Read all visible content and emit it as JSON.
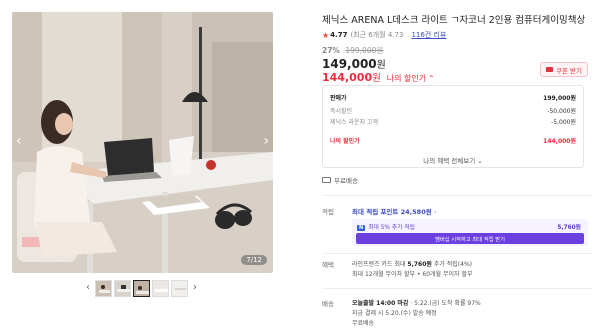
{
  "gallery": {
    "counter": "7/12",
    "prev_icon": "chevron-left-icon",
    "next_icon": "chevron-right-icon"
  },
  "product": {
    "title": "제닉스 ARENA L데스크 라이트 ㄱ자코너 2인용 컴퓨터게이밍책상",
    "rating": "4.77",
    "recent_rating": "(최근 6개월 4.73",
    "review_count": "116건 리뷰",
    "discount_pct": "27%",
    "original_price": "199,000원",
    "price": "149,000",
    "price_unit": "원",
    "my_price": "144,000",
    "my_price_unit": "원",
    "my_price_label": "나의 할인가",
    "coupon_label": "쿠폰 받기"
  },
  "breakdown": {
    "rows": [
      {
        "k": "판매가",
        "v": "199,000원"
      },
      {
        "k": "즉시할인",
        "v": "-50,000원"
      },
      {
        "k": "제닉스 라운지 고객",
        "v": "-5,000원"
      },
      {
        "k": "나의 할인가",
        "v": "144,000원"
      }
    ],
    "all_benefits": "나의 혜택 전체보기"
  },
  "shipping_free": "무료배송",
  "benefits": {
    "label": "적립",
    "points_text": "최대 적립 포인트 24,580원",
    "points_chevron": "›",
    "tag": "N",
    "extra_text": "최대 5% 추가 적립",
    "extra_amount": "5,760원",
    "button": "멤버십 시작하고 최대 적립 받기"
  },
  "payment": {
    "label": "혜택",
    "line1_pre": "라인프렌즈 카드 최대 ",
    "line1_bold": "5,760원",
    "line1_post": " 추가 적립(4%)",
    "line2": "최대 12개월 무이자 할부 • 60개월 무이자 할부"
  },
  "delivery": {
    "label": "배송",
    "line1_pre": "오늘출발 14:00 마감",
    "line1_post": " · 5.22.(금) 도착 확률 97%",
    "line2": "지금 결제 시 5.20.(수) 발송 예정",
    "line3": "무료배송"
  },
  "colors": {
    "accent_red": "#f02c3c",
    "accent_purple": "#6b3fe0",
    "link_blue": "#3b4cc0"
  }
}
